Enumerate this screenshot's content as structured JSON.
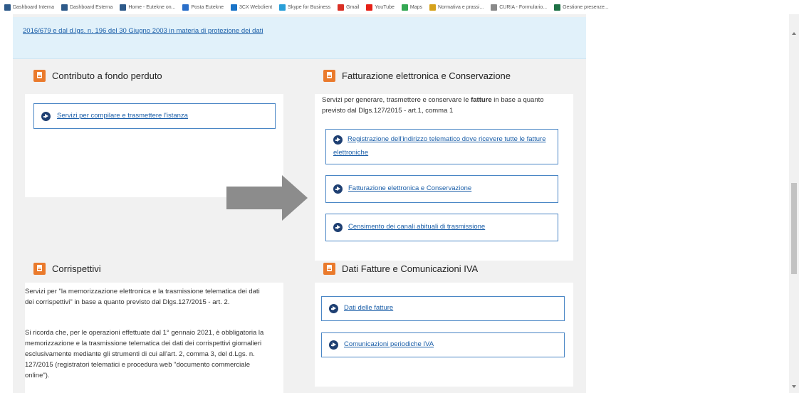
{
  "bookmarks": [
    {
      "label": "Dashboard Interna",
      "icon": "dashboard-icon",
      "color": "#2e5a8a"
    },
    {
      "label": "Dashboard Esterna",
      "icon": "dashboard-icon",
      "color": "#2e5a8a"
    },
    {
      "label": "Home - Eutekne on...",
      "icon": "eutekne-icon",
      "color": "#2e5a8a"
    },
    {
      "label": "Posta Eutekne",
      "icon": "mail-icon",
      "color": "#2a6fc9"
    },
    {
      "label": "3CX Webclient",
      "icon": "3cx-icon",
      "color": "#1a74c8"
    },
    {
      "label": "Skype for Business",
      "icon": "skype-icon",
      "color": "#2a9fd8"
    },
    {
      "label": "Gmail",
      "icon": "gmail-icon",
      "color": "#d93025"
    },
    {
      "label": "YouTube",
      "icon": "youtube-icon",
      "color": "#e62117"
    },
    {
      "label": "Maps",
      "icon": "maps-icon",
      "color": "#34a853"
    },
    {
      "label": "Normativa e prassi...",
      "icon": "normativa-icon",
      "color": "#d6a21c"
    },
    {
      "label": "CURIA - Formulario...",
      "icon": "curia-icon",
      "color": "#8a8a8a"
    },
    {
      "label": "Gestione presenze...",
      "icon": "excel-icon",
      "color": "#1e7145"
    }
  ],
  "notice": {
    "text": "2016/679 e dal d.lgs. n. 196 del 30 Giugno 2003 in materia di protezione dei dati"
  },
  "cards": {
    "contributo": {
      "title": "Contributo a fondo perduto",
      "links": [
        "Servizi per compilare e trasmettere l'istanza"
      ]
    },
    "fatturazione": {
      "title": "Fatturazione elettronica e Conservazione",
      "desc_pre": "Servizi per generare, trasmettere e conservare le ",
      "desc_bold": "fatture",
      "desc_post": " in base a quanto previsto dal Dlgs.127/2015 - art.1, comma 1",
      "links": [
        "Registrazione dell'indirizzo telematico dove ricevere tutte le fatture elettroniche",
        "Fatturazione elettronica e Conservazione",
        "Censimento dei canali abituali di trasmissione"
      ]
    },
    "corrispettivi": {
      "title": "Corrispettivi",
      "desc1": "Servizi per \"la memorizzazione elettronica e la trasmissione telematica dei dati dei corrispettivi\" in base a quanto previsto dal Dlgs.127/2015 - art. 2.",
      "desc2": "Si ricorda che, per le operazioni effettuate dal 1° gennaio 2021, è obbligatoria la memorizzazione e la trasmissione telematica dei dati dei corrispettivi giornalieri esclusivamente mediante gli strumenti di cui all'art. 2, comma 3, del d.Lgs. n. 127/2015 (registratori telematici e procedura web \"documento commerciale online\")."
    },
    "dati_fatture": {
      "title": "Dati Fatture e Comunicazioni IVA",
      "links": [
        "Dati delle fatture",
        "Comunicazioni periodiche IVA"
      ]
    }
  },
  "colors": {
    "accent_orange": "#ea7a2c",
    "link_blue": "#1a5ea8",
    "arrow_gray": "#8c8c8c"
  }
}
